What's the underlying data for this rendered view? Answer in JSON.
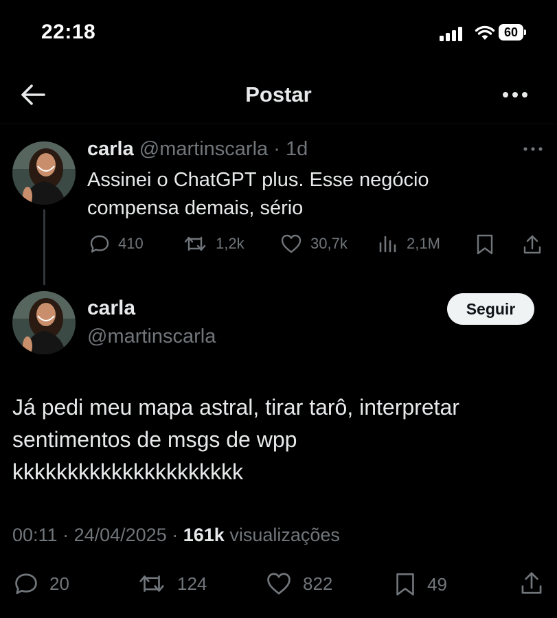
{
  "status_bar": {
    "time": "22:18",
    "battery": "60"
  },
  "header": {
    "title": "Postar"
  },
  "parent_tweet": {
    "name": "carla",
    "handle": "@martinscarla",
    "age": "· 1d",
    "text_lines": [
      "Assinei o ChatGPT plus. Esse negócio",
      "compensa demais, sério"
    ],
    "replies": "410",
    "reposts": "1,2k",
    "likes": "30,7k",
    "views": "2,1M"
  },
  "main_tweet": {
    "name": "carla",
    "handle": "@martinscarla",
    "follow_label": "Seguir",
    "text_lines": [
      "Já pedi meu mapa astral, tirar tarô, interpretar",
      "sentimentos de msgs de wpp",
      "kkkkkkkkkkkkkkkkkkkkk"
    ],
    "time": "00:11",
    "date": "24/04/2025",
    "views_count": "161k",
    "views_label": "visualizações",
    "replies": "20",
    "reposts": "124",
    "likes": "822",
    "bookmarks": "49"
  }
}
